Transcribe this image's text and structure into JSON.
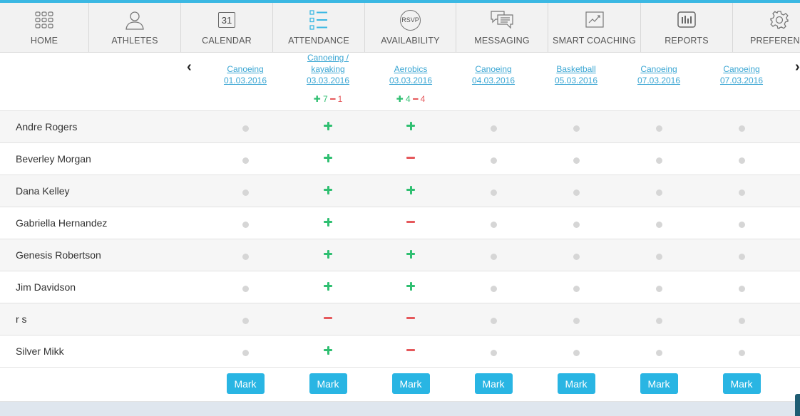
{
  "nav": {
    "items": [
      {
        "label": "HOME",
        "icon": "grid-icon"
      },
      {
        "label": "ATHLETES",
        "icon": "person-icon"
      },
      {
        "label": "CALENDAR",
        "icon": "calendar-icon",
        "icon_text": "31"
      },
      {
        "label": "ATTENDANCE",
        "icon": "checklist-icon"
      },
      {
        "label": "AVAILABILITY",
        "icon": "rsvp-icon",
        "icon_text": "RSVP"
      },
      {
        "label": "MESSAGING",
        "icon": "chat-bubbles-icon"
      },
      {
        "label": "SMART COACHING",
        "icon": "line-chart-icon"
      },
      {
        "label": "REPORTS",
        "icon": "bar-chart-icon"
      },
      {
        "label": "PREFERENCES",
        "icon": "gear-icon"
      }
    ]
  },
  "header": {
    "prev_arrow": "‹",
    "next_arrow": "›"
  },
  "events": [
    {
      "line1": "Canoeing",
      "line2": "",
      "date": "01.03.2016",
      "plus": "",
      "minus": ""
    },
    {
      "line1": "Canoeing /",
      "line2": "kayaking",
      "date": "03.03.2016",
      "plus": "7",
      "minus": "1"
    },
    {
      "line1": "Aerobics",
      "line2": "",
      "date": "03.03.2016",
      "plus": "4",
      "minus": "4"
    },
    {
      "line1": "Canoeing",
      "line2": "",
      "date": "04.03.2016",
      "plus": "",
      "minus": ""
    },
    {
      "line1": "Basketball",
      "line2": "",
      "date": "05.03.2016",
      "plus": "",
      "minus": ""
    },
    {
      "line1": "Canoeing",
      "line2": "",
      "date": "07.03.2016",
      "plus": "",
      "minus": ""
    },
    {
      "line1": "Canoeing",
      "line2": "",
      "date": "07.03.2016",
      "plus": "",
      "minus": ""
    }
  ],
  "athletes": [
    {
      "name": "Andre Rogers",
      "marks": [
        "none",
        "plus",
        "plus",
        "none",
        "none",
        "none",
        "none"
      ]
    },
    {
      "name": "Beverley Morgan",
      "marks": [
        "none",
        "plus",
        "minus",
        "none",
        "none",
        "none",
        "none"
      ]
    },
    {
      "name": "Dana Kelley",
      "marks": [
        "none",
        "plus",
        "plus",
        "none",
        "none",
        "none",
        "none"
      ]
    },
    {
      "name": "Gabriella Hernandez",
      "marks": [
        "none",
        "plus",
        "minus",
        "none",
        "none",
        "none",
        "none"
      ]
    },
    {
      "name": "Genesis Robertson",
      "marks": [
        "none",
        "plus",
        "plus",
        "none",
        "none",
        "none",
        "none"
      ]
    },
    {
      "name": "Jim Davidson",
      "marks": [
        "none",
        "plus",
        "plus",
        "none",
        "none",
        "none",
        "none"
      ]
    },
    {
      "name": "r s",
      "marks": [
        "none",
        "minus",
        "minus",
        "none",
        "none",
        "none",
        "none"
      ]
    },
    {
      "name": "Silver Mikk",
      "marks": [
        "none",
        "plus",
        "minus",
        "none",
        "none",
        "none",
        "none"
      ]
    }
  ],
  "mark_button_label": "Mark",
  "colors": {
    "accent": "#29b5e3",
    "link": "#3aa6d3",
    "present": "#2fbf71",
    "absent": "#e5585b",
    "unmarked": "#d6d6d6"
  }
}
